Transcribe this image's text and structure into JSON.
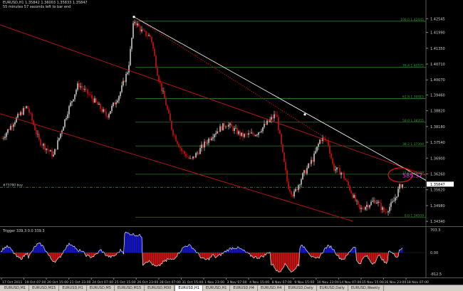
{
  "header": {
    "symbol_line": "EURUSD,H1  1.35842 1.36003 1.35833 1.35847",
    "timer": "55 minutes 57 seconds left to bar end"
  },
  "price_axis": {
    "ticks": [
      "1.42545",
      "1.41990",
      "1.41350",
      "1.40710",
      "1.40070",
      "1.39460",
      "1.38820",
      "1.38180",
      "1.37540",
      "1.36900",
      "1.36260",
      "1.35620",
      "1.34980",
      "1.34340"
    ],
    "min": 1.342,
    "max": 1.429
  },
  "current_price": {
    "value": 1.35847,
    "label": "1.35847"
  },
  "hline_label": "#73780 buy",
  "fib_levels": [
    {
      "label": "100.0 1.42445",
      "price": 1.42445
    },
    {
      "label": "76.4 1.40575",
      "price": 1.40575
    },
    {
      "label": "61.8 1.39315",
      "price": 1.39315
    },
    {
      "label": "50.0 1.38355",
      "price": 1.38355
    },
    {
      "label": "38.2 1.37394",
      "price": 1.37394
    },
    {
      "label": "23.6 1.36249",
      "price": 1.36249
    },
    {
      "label": "0.0 1.34509",
      "price": 1.34509
    }
  ],
  "annotation": {
    "label": "585.57",
    "color": "#e040e0"
  },
  "time_axis": [
    "17 Oct 2011",
    "19 Oct 07:00",
    "20 Oct 15:00",
    "21 Oct 23:00",
    "24 Oct 07:00",
    "25 Oct 15:00",
    "26 Oct 23:00",
    "28 Oct 07:00",
    "31 Oct 15:00",
    "1 Nov 23:00",
    "3 Nov 07:00",
    "4 Nov 15:00",
    "8 Nov 07:00",
    "9 Nov 15:00",
    "10 Nov 23:00",
    "14 Nov 07:00",
    "15 Nov 15:00",
    "16 Nov 23:00",
    "18 Nov 07:00"
  ],
  "indicator": {
    "title": "Trigger 339.3 0.0 339.3",
    "ticks": [
      "703.3",
      "0.00",
      "-812.5"
    ],
    "colors": {
      "positive": "#1515cc",
      "negative": "#d01515",
      "line": "#ffffff"
    }
  },
  "tabs": [
    "EURUSD,M1",
    "EURUSD,M15",
    "EURUSD,H1",
    "EURUSD,M5",
    "EURUSD,M15",
    "EURUSD,M30",
    "EURUSD,H1",
    "EURUSD,H1",
    "EURUSD,H4",
    "EURUSD,H4",
    "EURUSD,Daily",
    "EURUSD,Daily",
    "EURUSD,Weekly"
  ],
  "active_tab": 6,
  "colors": {
    "background": "#000000",
    "bull": "#c8c8c8",
    "bear": "#c81414",
    "channel": "#c81414",
    "trendline": "#ffffff",
    "fib": "#2a7a2a",
    "grid": "#2a2a2a"
  }
}
